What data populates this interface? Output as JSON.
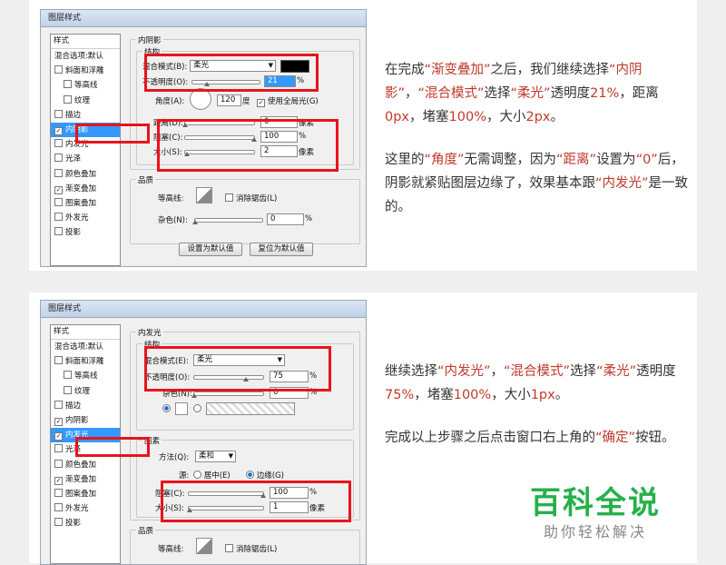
{
  "screen1": {
    "dialog_title": "图层样式",
    "styles_header": "样式",
    "styles": [
      {
        "label": "混合选项:默认",
        "checkbox": false,
        "checked": false,
        "indent": false,
        "selected": false
      },
      {
        "label": "斜面和浮雕",
        "checkbox": true,
        "checked": false,
        "indent": false,
        "selected": false
      },
      {
        "label": "等高线",
        "checkbox": true,
        "checked": false,
        "indent": true,
        "selected": false
      },
      {
        "label": "纹理",
        "checkbox": true,
        "checked": false,
        "indent": true,
        "selected": false
      },
      {
        "label": "描边",
        "checkbox": true,
        "checked": false,
        "indent": false,
        "selected": false
      },
      {
        "label": "内阴影",
        "checkbox": true,
        "checked": true,
        "indent": false,
        "selected": true
      },
      {
        "label": "内发光",
        "checkbox": true,
        "checked": false,
        "indent": false,
        "selected": false
      },
      {
        "label": "光泽",
        "checkbox": true,
        "checked": false,
        "indent": false,
        "selected": false
      },
      {
        "label": "颜色叠加",
        "checkbox": true,
        "checked": false,
        "indent": false,
        "selected": false
      },
      {
        "label": "渐变叠加",
        "checkbox": true,
        "checked": true,
        "indent": false,
        "selected": false
      },
      {
        "label": "图案叠加",
        "checkbox": true,
        "checked": false,
        "indent": false,
        "selected": false
      },
      {
        "label": "外发光",
        "checkbox": true,
        "checked": false,
        "indent": false,
        "selected": false
      },
      {
        "label": "投影",
        "checkbox": true,
        "checked": false,
        "indent": false,
        "selected": false
      }
    ],
    "section_title": "内阴影",
    "structure_title": "结构",
    "blend_mode_label": "混合模式(B):",
    "blend_mode_value": "柔光",
    "opacity_label": "不透明度(O):",
    "opacity_value": "21",
    "opacity_fraction": 0.21,
    "angle_label": "角度(A):",
    "angle_value": "120",
    "angle_unit": "度",
    "global_light_label": "使用全局光(G)",
    "distance_label": "距离(D):",
    "distance_value": "0",
    "distance_fraction": 0.0,
    "choke_label": "阻塞(C):",
    "choke_value": "100",
    "choke_fraction": 1.0,
    "size_label": "大小(S):",
    "size_value": "2",
    "size_fraction": 0.02,
    "percent": "%",
    "px_unit": "像素",
    "quality_title": "品质",
    "contour_label": "等高线:",
    "antialias_label": "消除锯齿(L)",
    "noise_label": "杂色(N):",
    "noise_value": "0",
    "set_default_btn": "设置为默认值",
    "reset_default_btn": "复位为默认值"
  },
  "text1": {
    "p1": [
      "在完成",
      "“渐变叠加”",
      "之后，我们继续选择",
      "“内阴影”",
      "，",
      "“混合模式”",
      "选择",
      "“柔光”",
      "透明度",
      "21%",
      "，距离",
      "0px",
      "，堵塞",
      "100%",
      "，大小",
      "2px",
      "。"
    ],
    "p2": [
      "这里的",
      "“角度”",
      "无需调整，因为",
      "“距离”",
      "设置为",
      "“0”",
      "后，阴影就紧贴图层边缘了，效果基本跟",
      "“内发光”",
      "是一致的。"
    ]
  },
  "screen2": {
    "dialog_title": "图层样式",
    "styles_header": "样式",
    "styles": [
      {
        "label": "混合选项:默认",
        "checkbox": false,
        "checked": false,
        "indent": false,
        "selected": false
      },
      {
        "label": "斜面和浮雕",
        "checkbox": true,
        "checked": false,
        "indent": false,
        "selected": false
      },
      {
        "label": "等高线",
        "checkbox": true,
        "checked": false,
        "indent": true,
        "selected": false
      },
      {
        "label": "纹理",
        "checkbox": true,
        "checked": false,
        "indent": true,
        "selected": false
      },
      {
        "label": "描边",
        "checkbox": true,
        "checked": false,
        "indent": false,
        "selected": false
      },
      {
        "label": "内阴影",
        "checkbox": true,
        "checked": true,
        "indent": false,
        "selected": false
      },
      {
        "label": "内发光",
        "checkbox": true,
        "checked": true,
        "indent": false,
        "selected": true
      },
      {
        "label": "光泽",
        "checkbox": true,
        "checked": false,
        "indent": false,
        "selected": false
      },
      {
        "label": "颜色叠加",
        "checkbox": true,
        "checked": false,
        "indent": false,
        "selected": false
      },
      {
        "label": "渐变叠加",
        "checkbox": true,
        "checked": true,
        "indent": false,
        "selected": false
      },
      {
        "label": "图案叠加",
        "checkbox": true,
        "checked": false,
        "indent": false,
        "selected": false
      },
      {
        "label": "外发光",
        "checkbox": true,
        "checked": false,
        "indent": false,
        "selected": false
      },
      {
        "label": "投影",
        "checkbox": true,
        "checked": false,
        "indent": false,
        "selected": false
      }
    ],
    "section_title": "内发光",
    "structure_title": "结构",
    "blend_mode_label": "混合模式(E):",
    "blend_mode_value": "柔光",
    "opacity_label": "不透明度(O):",
    "opacity_value": "75",
    "opacity_fraction": 0.75,
    "noise_label": "杂色(N):",
    "noise_value": "0",
    "elements_title": "图素",
    "method_label": "方法(Q):",
    "method_value": "柔和",
    "source_label": "源:",
    "source_center": "居中(E)",
    "source_edge": "边缘(G)",
    "choke_label": "阻塞(C):",
    "choke_value": "100",
    "choke_fraction": 1.0,
    "size_label": "大小(S):",
    "size_value": "1",
    "size_fraction": 0.01,
    "percent": "%",
    "px_unit": "像素",
    "quality_title": "品质",
    "contour_label": "等高线:",
    "antialias_label": "消除锯齿(L)"
  },
  "text2": {
    "p1": [
      "继续选择",
      "“内发光”",
      "，",
      "“混合模式”",
      "选择",
      "“柔光”",
      "透明度",
      "75%",
      "，堵塞",
      "100%",
      "，大小",
      "1px",
      "。"
    ],
    "p2": [
      "完成以上步骤之后点击窗口右上角的",
      "“确定”",
      "按钮。"
    ]
  },
  "watermark": {
    "title": "百科全说",
    "subtitle": "助你轻松解决"
  },
  "colors": {
    "highlight_red": "#e8141b",
    "text_red": "#c0392b",
    "brand_green": "#26b04a"
  }
}
